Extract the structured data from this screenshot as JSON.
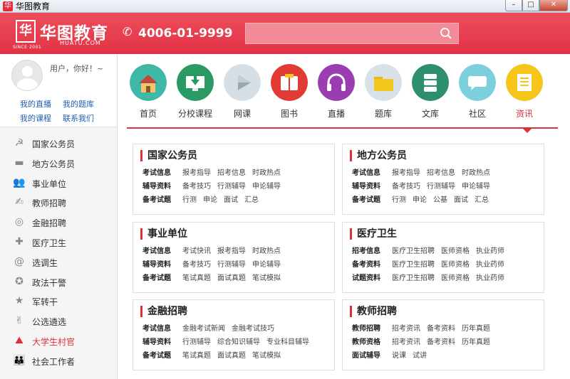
{
  "window": {
    "title": "华图教育",
    "btn_min": "–",
    "btn_max": "□",
    "btn_close": "✕"
  },
  "header": {
    "logo_mark": "华",
    "logo_text": "华图教育",
    "logo_sub": "HUATU.COM",
    "logo_since": "SINCE 2001",
    "phone": "4006-01-9999",
    "search_placeholder": ""
  },
  "user": {
    "greeting": "用户，你好！~",
    "links": [
      "我的直播",
      "我的题库",
      "我的课程",
      "联系我们"
    ]
  },
  "sidebar": [
    {
      "label": "国家公务员",
      "icon": "emblem-icon",
      "glyph": "☭"
    },
    {
      "label": "地方公务员",
      "icon": "ribbon-icon",
      "glyph": "▬"
    },
    {
      "label": "事业单位",
      "icon": "people-icon",
      "glyph": "👥"
    },
    {
      "label": "教师招聘",
      "icon": "teacher-icon",
      "glyph": "✍"
    },
    {
      "label": "金融招聘",
      "icon": "coin-icon",
      "glyph": "◎"
    },
    {
      "label": "医疗卫生",
      "icon": "cross-icon",
      "glyph": "✚"
    },
    {
      "label": "选调生",
      "icon": "swirl-icon",
      "glyph": "@"
    },
    {
      "label": "政法干警",
      "icon": "badge-icon",
      "glyph": "✪"
    },
    {
      "label": "军转干",
      "icon": "star-icon",
      "glyph": "★"
    },
    {
      "label": "公选遴选",
      "icon": "thumb-icon",
      "glyph": "✌"
    },
    {
      "label": "大学生村官",
      "icon": "mountain-icon",
      "glyph": "⛰",
      "active": true
    },
    {
      "label": "社会工作者",
      "icon": "group-icon",
      "glyph": "👪"
    }
  ],
  "nav": [
    {
      "label": "首页",
      "icon": "home-icon",
      "color": "#3fb8a7"
    },
    {
      "label": "分校课程",
      "icon": "download-monitor-icon",
      "color": "#2a9a64"
    },
    {
      "label": "网课",
      "icon": "play-icon",
      "color": "#d6dfe5"
    },
    {
      "label": "图书",
      "icon": "book-icon",
      "color": "#e03b34"
    },
    {
      "label": "直播",
      "icon": "headphones-icon",
      "color": "#9a3db0"
    },
    {
      "label": "题库",
      "icon": "folder-icon",
      "color": "#d7e1e7"
    },
    {
      "label": "文库",
      "icon": "database-icon",
      "color": "#2d8f6c"
    },
    {
      "label": "社区",
      "icon": "chat-icon",
      "color": "#7ccfdc"
    },
    {
      "label": "资讯",
      "icon": "document-icon",
      "color": "#f5c51c",
      "active": true
    }
  ],
  "cards": [
    {
      "title": "国家公务员",
      "rows": [
        {
          "label": "考试信息",
          "links": [
            "报考指导",
            "招考信息",
            "时政热点"
          ]
        },
        {
          "label": "辅导资料",
          "links": [
            "备考技巧",
            "行测辅导",
            "申论辅导"
          ]
        },
        {
          "label": "备考试题",
          "links": [
            "行测",
            "申论",
            "面试",
            "汇总"
          ]
        }
      ]
    },
    {
      "title": "地方公务员",
      "rows": [
        {
          "label": "考试信息",
          "links": [
            "报考指导",
            "招考信息",
            "时政热点"
          ]
        },
        {
          "label": "辅导资料",
          "links": [
            "备考技巧",
            "行测辅导",
            "申论辅导"
          ]
        },
        {
          "label": "备考试题",
          "links": [
            "行测",
            "申论",
            "公基",
            "面试",
            "汇总"
          ]
        }
      ]
    },
    {
      "title": "事业单位",
      "rows": [
        {
          "label": "考试信息",
          "links": [
            "考试快讯",
            "报考指导",
            "时政热点"
          ]
        },
        {
          "label": "辅导资料",
          "links": [
            "备考技巧",
            "行测辅导",
            "申论辅导"
          ]
        },
        {
          "label": "备考试题",
          "links": [
            "笔试真题",
            "面试真题",
            "笔试模拟"
          ]
        }
      ]
    },
    {
      "title": "医疗卫生",
      "rows": [
        {
          "label": "招考信息",
          "links": [
            "医疗卫生招聘",
            "医师资格",
            "执业药师"
          ]
        },
        {
          "label": "备考资料",
          "links": [
            "医疗卫生招聘",
            "医师资格",
            "执业药师"
          ]
        },
        {
          "label": "试题资料",
          "links": [
            "医疗卫生招聘",
            "医师资格",
            "执业药师"
          ]
        }
      ]
    },
    {
      "title": "金融招聘",
      "rows": [
        {
          "label": "考试信息",
          "links": [
            "金融考试新闻",
            "金融考试技巧"
          ]
        },
        {
          "label": "辅导资料",
          "links": [
            "行测辅导",
            "综合知识辅导",
            "专业科目辅导"
          ]
        },
        {
          "label": "备考试题",
          "links": [
            "笔试真题",
            "面试真题",
            "笔试模拟"
          ]
        }
      ]
    },
    {
      "title": "教师招聘",
      "rows": [
        {
          "label": "教师招聘",
          "links": [
            "招考资讯",
            "备考资料",
            "历年真题"
          ]
        },
        {
          "label": "教师资格",
          "links": [
            "招考资讯",
            "备考资料",
            "历年真题"
          ]
        },
        {
          "label": "面试辅导",
          "links": [
            "说课",
            "试讲"
          ]
        }
      ]
    }
  ]
}
